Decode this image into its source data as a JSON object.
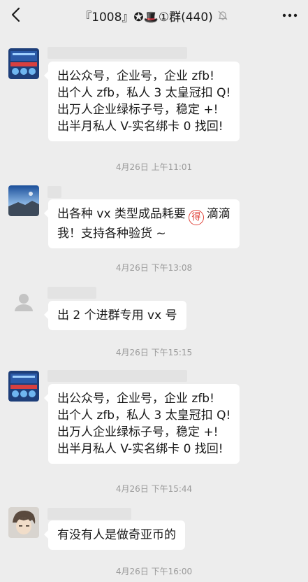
{
  "header": {
    "title": "『1008』✪🎩①群(440)",
    "back_icon": "back-arrow-icon",
    "mute_icon": "muted-bell-icon",
    "more_icon": "more-dots-icon"
  },
  "messages": [
    {
      "avatar": "banner-logo-avatar",
      "lines": [
        "出公众号，企业号，企业 zfb!",
        "出个人 zfb，私人 3 太皇冠扣 Q!",
        "出万人企业绿标子号，稳定 +!",
        "出半月私人 V-实名绑卡 0 找回!"
      ]
    },
    {
      "time": "4月26日 上午11:01"
    },
    {
      "avatar": "landscape-avatar",
      "line1_pre": "出各种 vx 类型成品耗要",
      "emoji": "得",
      "line1_post": "滴滴",
      "line2": "我！支持各种验货 ~"
    },
    {
      "time": "4月26日 下午13:08"
    },
    {
      "avatar": "default-person-avatar",
      "lines": [
        "出 2 个进群专用 vx 号"
      ]
    },
    {
      "time": "4月26日 下午15:15"
    },
    {
      "avatar": "banner-logo-avatar",
      "lines": [
        "出公众号，企业号，企业 zfb!",
        "出个人 zfb，私人 3 太皇冠扣 Q!",
        "出万人企业绿标子号，稳定 +!",
        "出半月私人 V-实名绑卡 0 找回!"
      ]
    },
    {
      "time": "4月26日 下午15:44"
    },
    {
      "avatar": "anime-character-avatar",
      "lines": [
        "有没有人是做奇亚币的"
      ]
    },
    {
      "time": "4月26日 下午16:00"
    }
  ]
}
